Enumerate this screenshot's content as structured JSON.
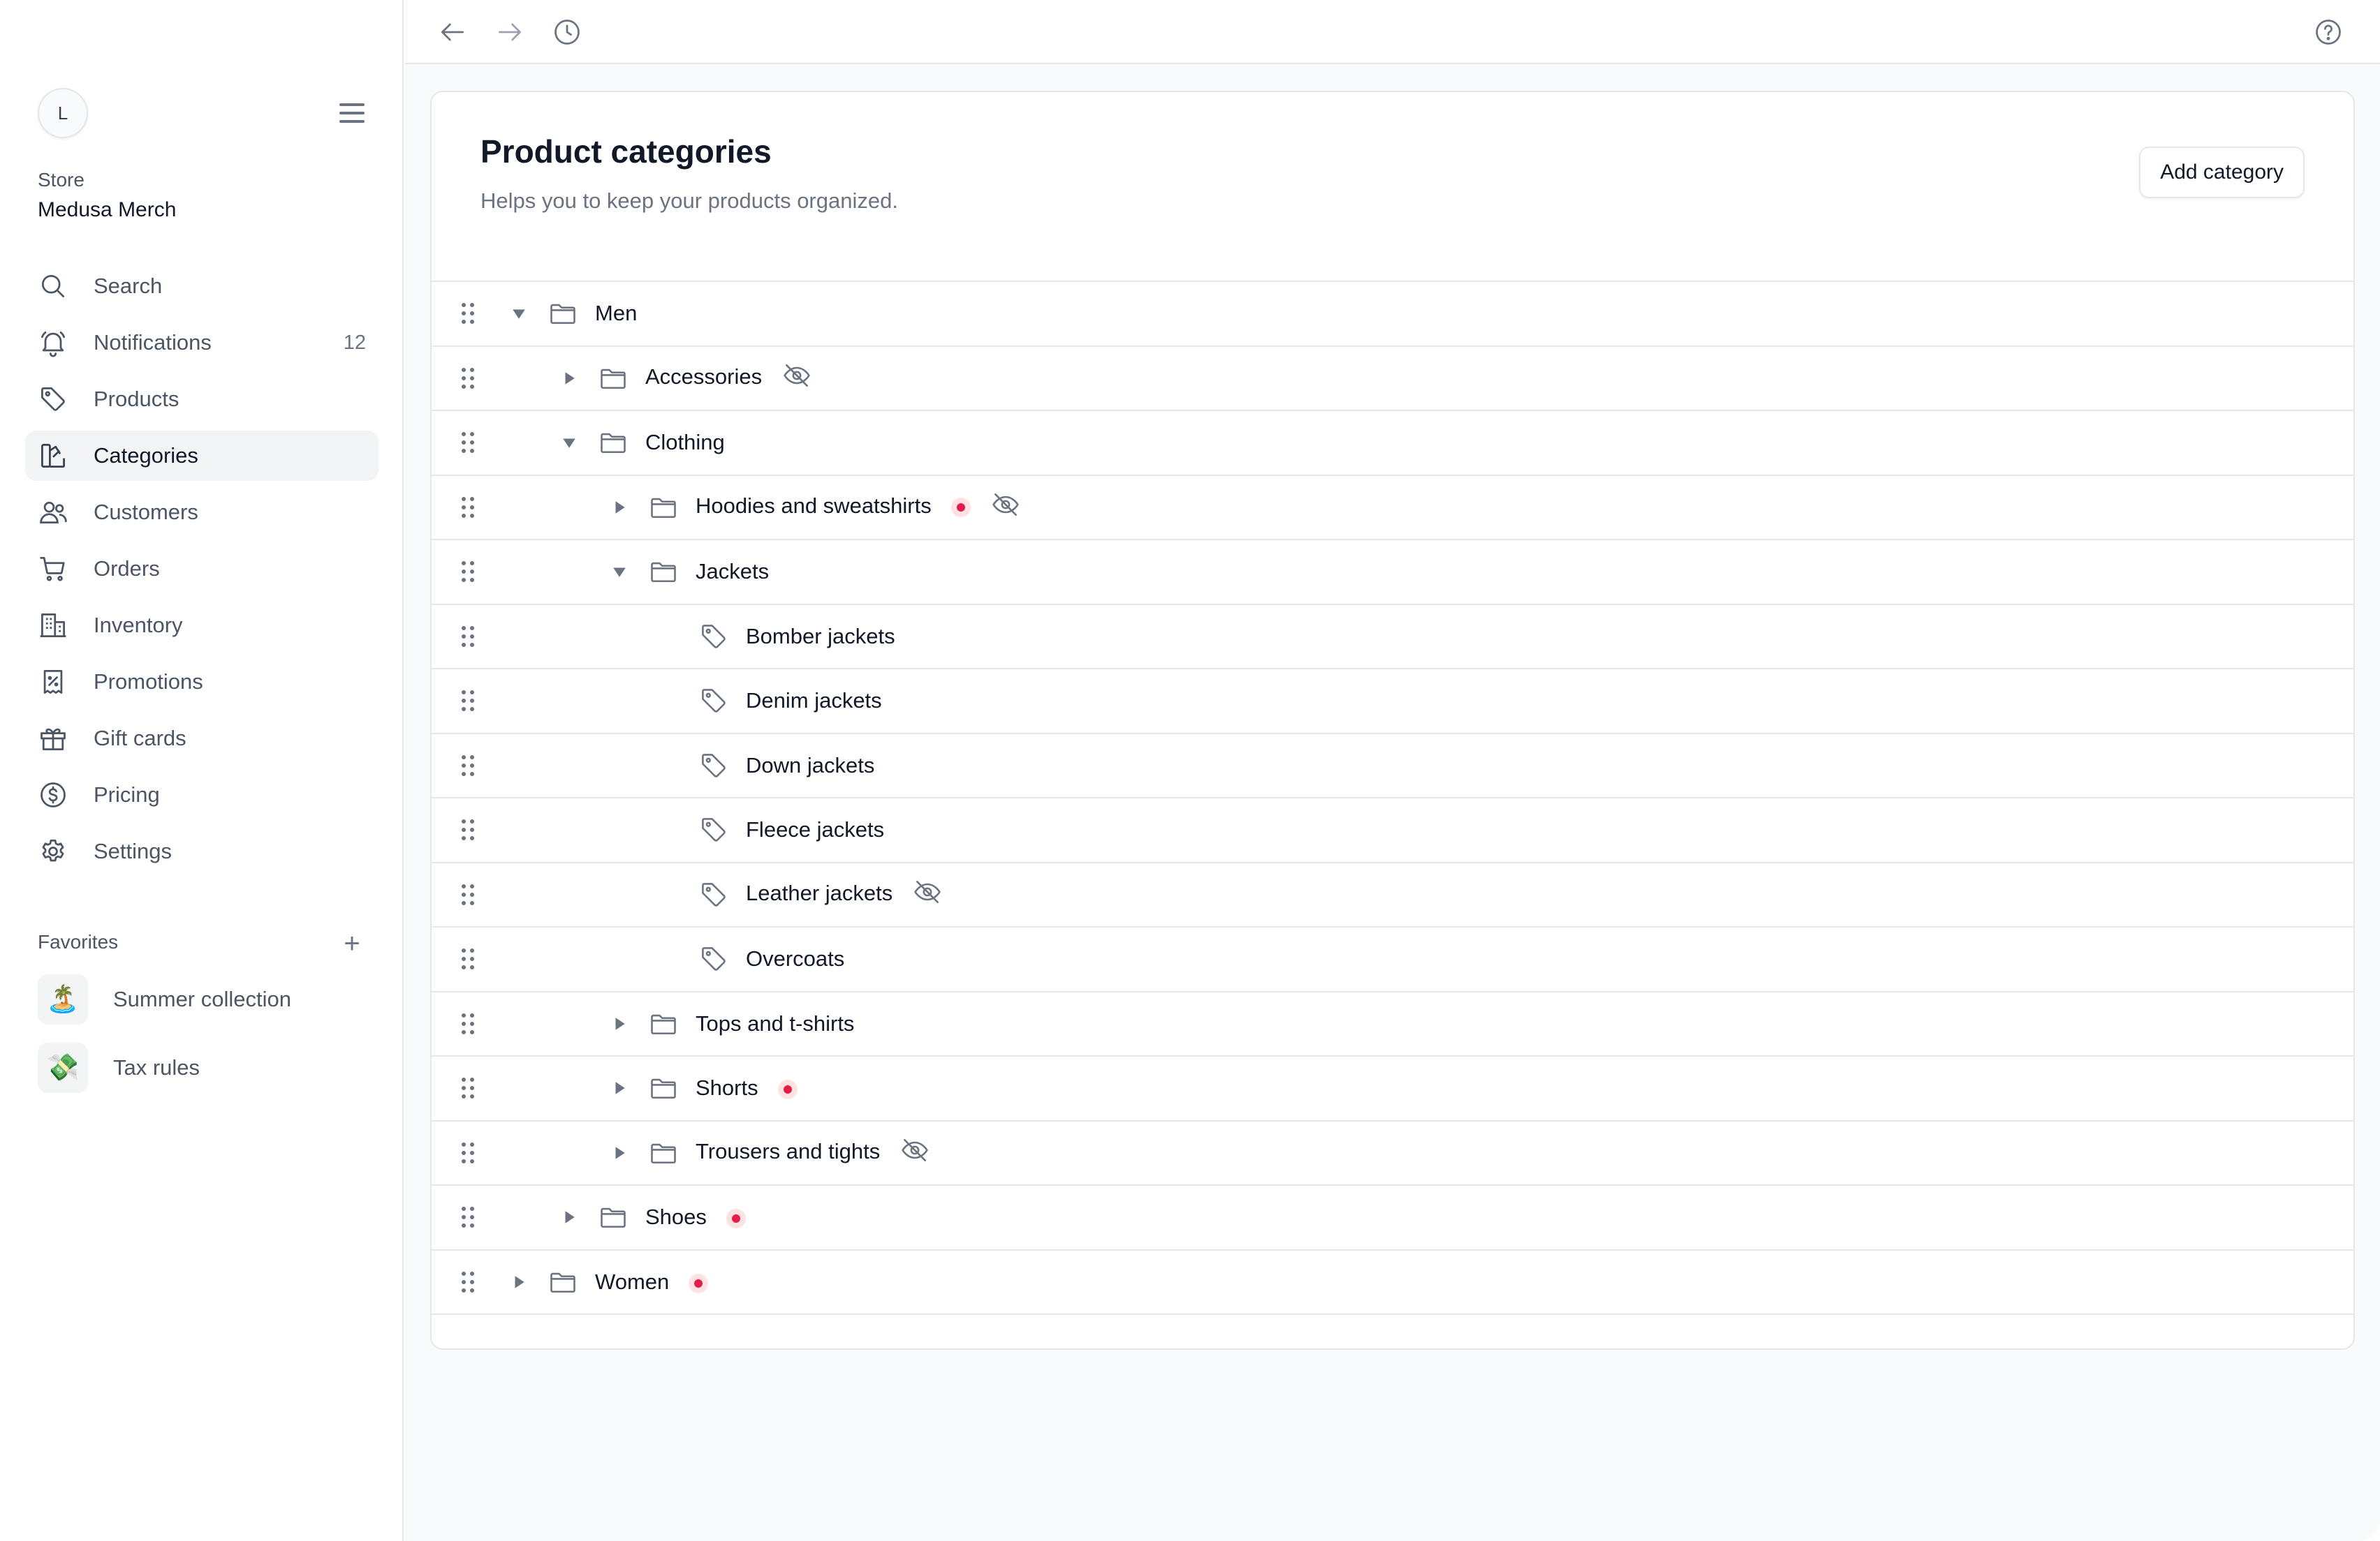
{
  "sidebar": {
    "avatar_initial": "L",
    "store_label": "Store",
    "store_name": "Medusa Merch",
    "nav": [
      {
        "label": "Search",
        "icon": "search-icon"
      },
      {
        "label": "Notifications",
        "icon": "bell-icon",
        "count": "12"
      },
      {
        "label": "Products",
        "icon": "tag-icon"
      },
      {
        "label": "Categories",
        "icon": "categories-icon",
        "active": true
      },
      {
        "label": "Customers",
        "icon": "users-icon"
      },
      {
        "label": "Orders",
        "icon": "cart-icon"
      },
      {
        "label": "Inventory",
        "icon": "building-icon"
      },
      {
        "label": "Promotions",
        "icon": "receipt-percent-icon"
      },
      {
        "label": "Gift cards",
        "icon": "gift-icon"
      },
      {
        "label": "Pricing",
        "icon": "currency-dollar-icon"
      },
      {
        "label": "Settings",
        "icon": "gear-icon"
      }
    ],
    "favorites_title": "Favorites",
    "favorites_add": "+",
    "favorites": [
      {
        "label": "Summer collection",
        "icon": "island-emoji",
        "glyph": "🏝️"
      },
      {
        "label": "Tax rules",
        "icon": "money-emoji",
        "glyph": "💸"
      }
    ]
  },
  "topbar": {
    "icons": [
      "arrow-left-icon",
      "arrow-right-icon",
      "history-icon",
      "help-icon"
    ]
  },
  "page": {
    "title": "Product categories",
    "subtitle": "Helps you to keep your products organized.",
    "add_button": "Add category"
  },
  "categories": [
    {
      "label": "Men",
      "depth": 0,
      "type": "folder",
      "expanded": true
    },
    {
      "label": "Accessories",
      "depth": 1,
      "type": "folder",
      "expanded": false,
      "hidden": true
    },
    {
      "label": "Clothing",
      "depth": 1,
      "type": "folder",
      "expanded": true
    },
    {
      "label": "Hoodies and sweatshirts",
      "depth": 2,
      "type": "folder",
      "expanded": false,
      "inactive": true,
      "hidden": true
    },
    {
      "label": "Jackets",
      "depth": 2,
      "type": "folder",
      "expanded": true
    },
    {
      "label": "Bomber jackets",
      "depth": 3,
      "type": "tag"
    },
    {
      "label": "Denim jackets",
      "depth": 3,
      "type": "tag"
    },
    {
      "label": "Down jackets",
      "depth": 3,
      "type": "tag"
    },
    {
      "label": "Fleece jackets",
      "depth": 3,
      "type": "tag"
    },
    {
      "label": "Leather jackets",
      "depth": 3,
      "type": "tag",
      "hidden": true
    },
    {
      "label": "Overcoats",
      "depth": 3,
      "type": "tag"
    },
    {
      "label": "Tops and t-shirts",
      "depth": 2,
      "type": "folder",
      "expanded": false
    },
    {
      "label": "Shorts",
      "depth": 2,
      "type": "folder",
      "expanded": false,
      "inactive": true
    },
    {
      "label": "Trousers and tights",
      "depth": 2,
      "type": "folder",
      "expanded": false,
      "hidden": true
    },
    {
      "label": "Shoes",
      "depth": 1,
      "type": "folder",
      "expanded": false,
      "inactive": true
    },
    {
      "label": "Women",
      "depth": 0,
      "type": "folder",
      "expanded": false,
      "inactive": true
    }
  ],
  "colors": {
    "inactive_dot": "#e11d48",
    "border": "#e5e7eb",
    "muted_text": "#6b7280"
  }
}
